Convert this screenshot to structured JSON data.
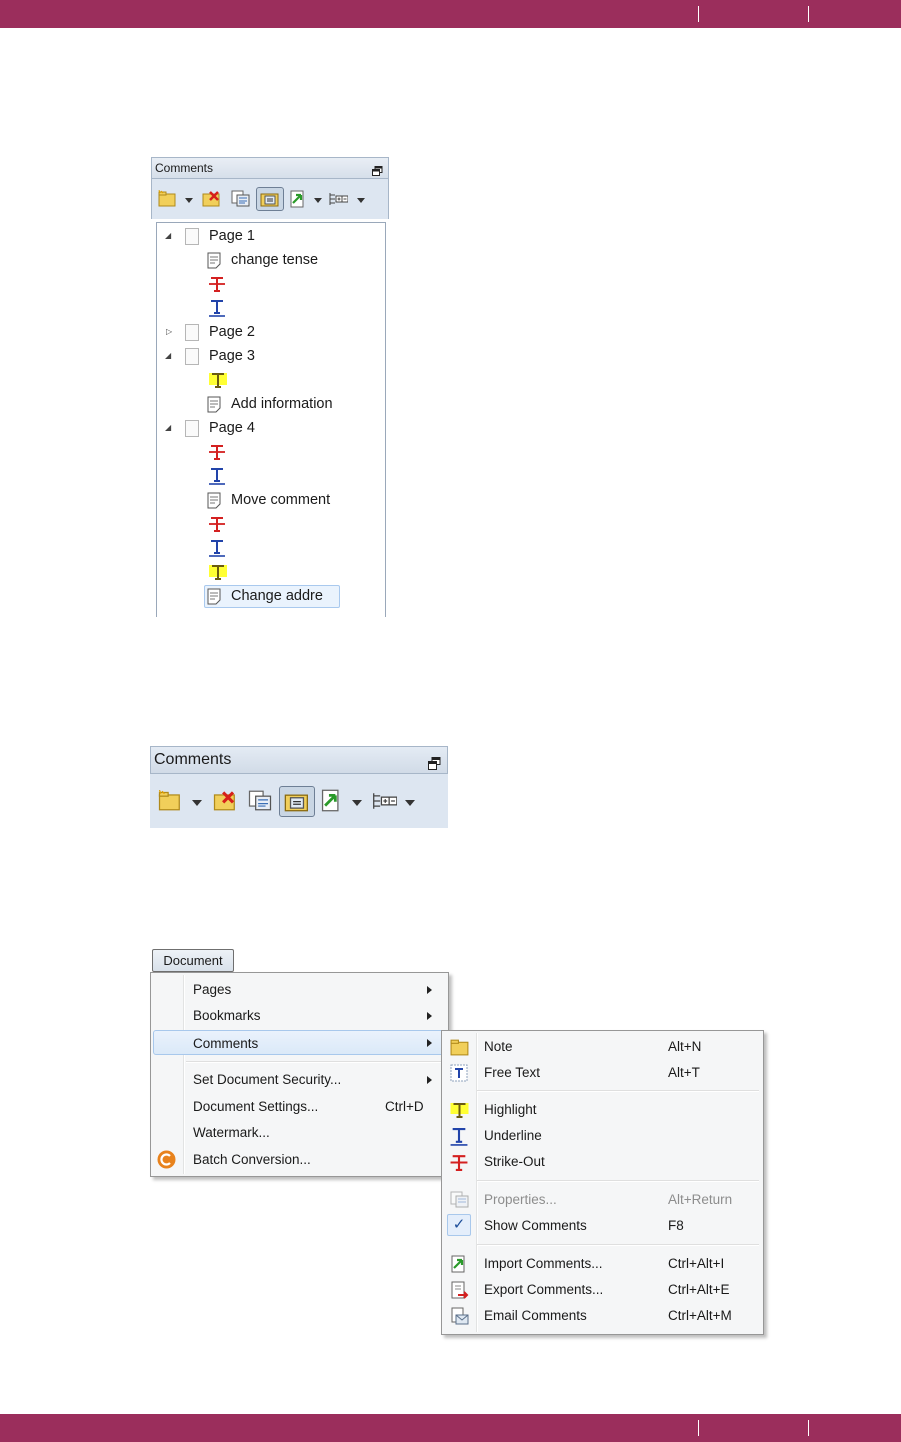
{
  "colors": {
    "brand_bar": "#9b2e5c",
    "panel_bg": "#dde6f1",
    "highlight": "#ffff33",
    "strike": "#d42020",
    "underline": "#2244aa"
  },
  "panel1": {
    "title": "Comments",
    "tree": [
      {
        "kind": "page",
        "label": "Page 1",
        "expanded": true
      },
      {
        "kind": "note",
        "label": "change tense"
      },
      {
        "kind": "strike",
        "label": ""
      },
      {
        "kind": "underline",
        "label": ""
      },
      {
        "kind": "page",
        "label": "Page 2",
        "expanded": false
      },
      {
        "kind": "page",
        "label": "Page 3",
        "expanded": true
      },
      {
        "kind": "highlight",
        "label": ""
      },
      {
        "kind": "note",
        "label": "Add information"
      },
      {
        "kind": "page",
        "label": "Page 4",
        "expanded": true
      },
      {
        "kind": "strike",
        "label": ""
      },
      {
        "kind": "underline",
        "label": ""
      },
      {
        "kind": "note",
        "label": "Move comment"
      },
      {
        "kind": "strike",
        "label": ""
      },
      {
        "kind": "underline",
        "label": ""
      },
      {
        "kind": "highlight",
        "label": ""
      },
      {
        "kind": "note",
        "label": "Change addre",
        "selected": true
      }
    ]
  },
  "panel2": {
    "title": "Comments"
  },
  "toolbar_icons": [
    "new-comment-icon",
    "delete-comment-icon",
    "properties-icon",
    "show-comments-icon",
    "import-comments-icon",
    "expand-collapse-icon"
  ],
  "document_menu": {
    "button": "Document",
    "items": [
      {
        "label": "Pages",
        "submenu": true
      },
      {
        "label": "Bookmarks",
        "submenu": true
      },
      {
        "label": "Comments",
        "submenu": true,
        "highlighted": true
      },
      {
        "label": "Set Document Security...",
        "submenu": true
      },
      {
        "label": "Document Settings...",
        "shortcut": "Ctrl+D"
      },
      {
        "label": "Watermark..."
      },
      {
        "label": "Batch Conversion...",
        "icon": "batch-conversion-icon"
      }
    ]
  },
  "comments_submenu": {
    "items": [
      {
        "label": "Note",
        "shortcut": "Alt+N",
        "icon": "note-icon"
      },
      {
        "label": "Free Text",
        "shortcut": "Alt+T",
        "icon": "free-text-icon"
      },
      {
        "label": "Highlight",
        "shortcut": "",
        "icon": "highlight-icon"
      },
      {
        "label": "Underline",
        "shortcut": "",
        "icon": "underline-icon"
      },
      {
        "label": "Strike-Out",
        "shortcut": "",
        "icon": "strikeout-icon"
      },
      {
        "label": "Properties...",
        "shortcut": "Alt+Return",
        "icon": "properties-icon",
        "disabled": true
      },
      {
        "label": "Show Comments",
        "shortcut": "F8",
        "checked": true
      },
      {
        "label": "Import Comments...",
        "shortcut": "Ctrl+Alt+I",
        "icon": "import-icon"
      },
      {
        "label": "Export Comments...",
        "shortcut": "Ctrl+Alt+E",
        "icon": "export-icon"
      },
      {
        "label": "Email Comments",
        "shortcut": "Ctrl+Alt+M",
        "icon": "email-icon"
      }
    ]
  }
}
